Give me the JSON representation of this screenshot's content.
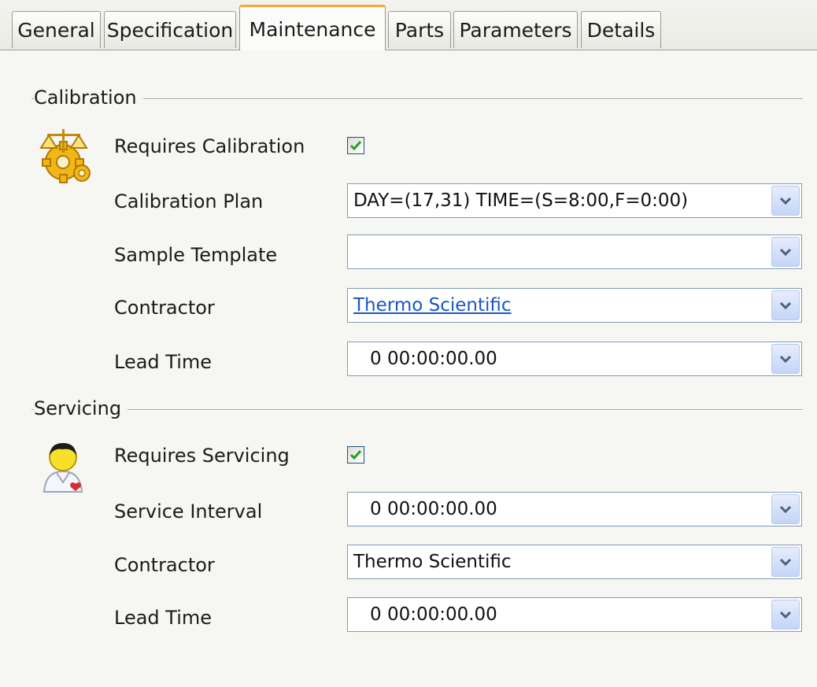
{
  "tabs": [
    {
      "label": "General"
    },
    {
      "label": "Specification"
    },
    {
      "label": "Maintenance"
    },
    {
      "label": "Parts"
    },
    {
      "label": "Parameters"
    },
    {
      "label": "Details"
    }
  ],
  "active_tab": "Maintenance",
  "calibration": {
    "group_title": "Calibration",
    "icon": "balance-scale-gear-icon",
    "requires_label": "Requires Calibration",
    "requires_checked": true,
    "plan_label": "Calibration Plan",
    "plan_value": "DAY=(17,31) TIME=(S=8:00,F=0:00)",
    "template_label": "Sample Template",
    "template_value": "",
    "contractor_label": "Contractor",
    "contractor_value": "Thermo Scientific",
    "lead_time_label": "Lead Time",
    "lead_time_value": "0 00:00:00.00"
  },
  "servicing": {
    "group_title": "Servicing",
    "icon": "service-technician-icon",
    "requires_label": "Requires Servicing",
    "requires_checked": true,
    "interval_label": "Service Interval",
    "interval_value": "0 00:00:00.00",
    "contractor_label": "Contractor",
    "contractor_value": "Thermo Scientific",
    "lead_time_label": "Lead Time",
    "lead_time_value": "0 00:00:00.00"
  },
  "colors": {
    "active_tab_accent": "#f4a935",
    "link": "#1a56c4",
    "checkmark": "#21a121",
    "combo_border": "#7f9db9"
  }
}
